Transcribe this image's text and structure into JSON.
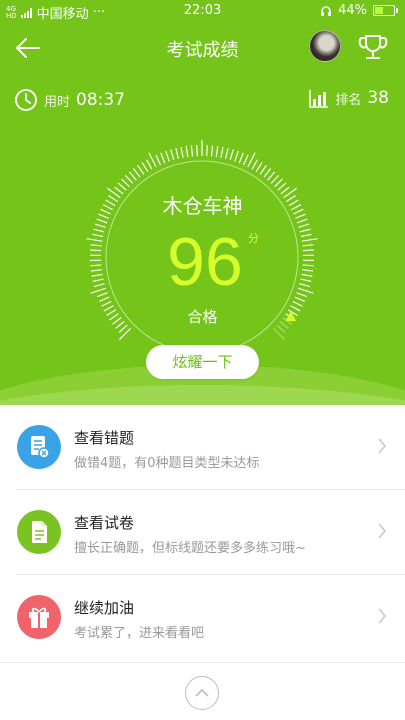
{
  "status_bar": {
    "signal_tag": "4G\nHD",
    "carrier": "中国移动",
    "dots": "···",
    "time": "22:03",
    "battery": "44%",
    "battery_level": 0.44
  },
  "nav": {
    "title": "考试成绩"
  },
  "stats": {
    "time_label": "用时",
    "time_value": "08:37",
    "rank_label": "排名",
    "rank_value": "38"
  },
  "result": {
    "name": "木仓车神",
    "score": "96",
    "unit": "分",
    "level": "合格",
    "score_fraction": 0.96
  },
  "share_button": "炫耀一下",
  "items": [
    {
      "title": "查看错题",
      "subtitle": "做错4题，有0种题目类型未达标",
      "icon": "wrong-questions-icon",
      "color": "#3aa3e8"
    },
    {
      "title": "查看试卷",
      "subtitle": "擅长正确题，但标线题还要多多练习哦~",
      "icon": "paper-icon",
      "color": "#7bc322"
    },
    {
      "title": "继续加油",
      "subtitle": "考试累了，进来看看吧",
      "icon": "gift-icon",
      "color": "#f0636a"
    }
  ],
  "colors": {
    "header_green": "#74c41a",
    "score_yellow": "#d7ff2c"
  }
}
